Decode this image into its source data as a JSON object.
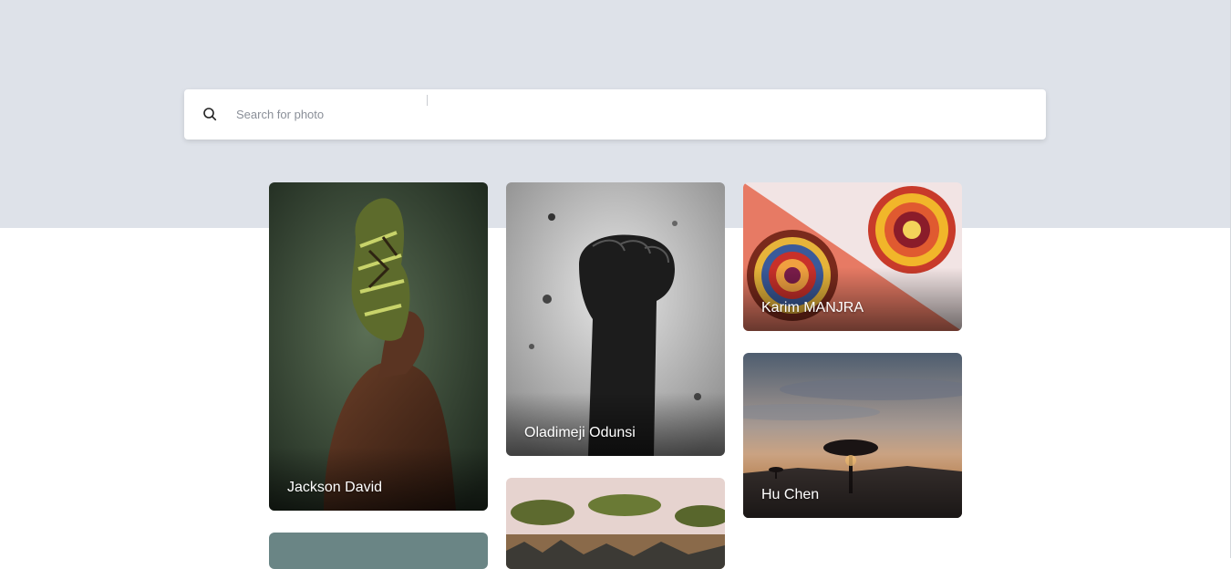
{
  "search": {
    "placeholder": "Search for photo",
    "value": ""
  },
  "cards": [
    {
      "name": "Jackson David",
      "icon": "photo-portrait-headwrap"
    },
    {
      "name": "Oladimeji Odunsi",
      "icon": "photo-raised-fist"
    },
    {
      "name": "Karim MANJRA",
      "icon": "photo-woven-baskets"
    },
    {
      "name": "Hu Chen",
      "icon": "photo-savanna-sunset"
    },
    {
      "name": "",
      "icon": "photo-teal"
    },
    {
      "name": "",
      "icon": "photo-safari"
    }
  ],
  "colors": {
    "hero_background": "#dee2e9",
    "page_background": "#ffffff",
    "caption_text": "#ffffff"
  }
}
